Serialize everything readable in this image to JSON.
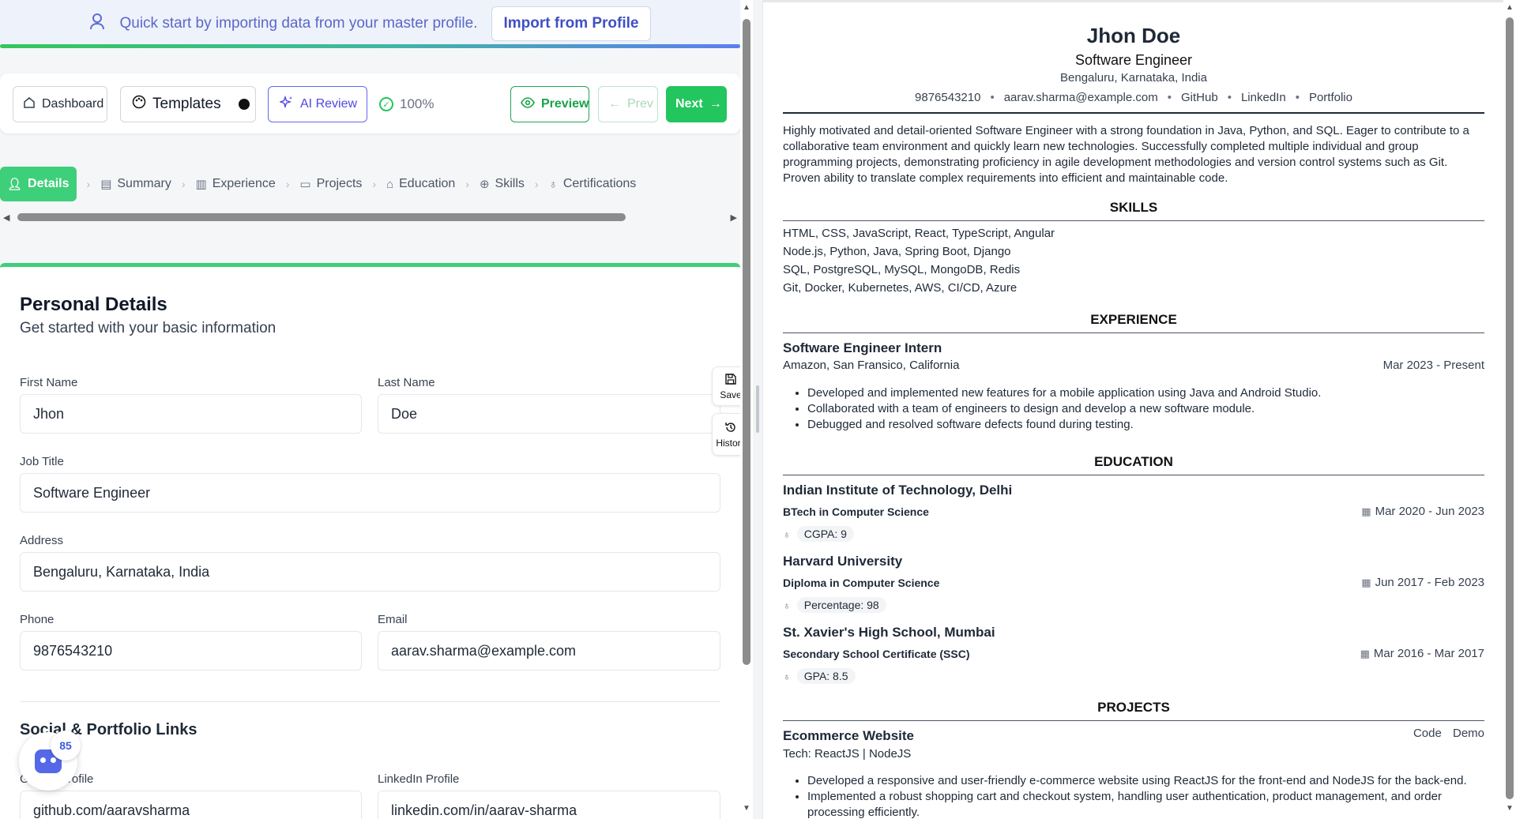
{
  "banner": {
    "text": "Quick start by importing data from your master profile.",
    "import_label": "Import from Profile"
  },
  "toolbar": {
    "dashboard": "Dashboard",
    "templates": "Templates",
    "ai_review": "AI Review",
    "completion": "100%",
    "preview": "Preview",
    "prev": "Prev",
    "next": "Next"
  },
  "steps": [
    {
      "label": "Details",
      "icon": "user-icon",
      "active": true
    },
    {
      "label": "Summary",
      "icon": "document-icon"
    },
    {
      "label": "Experience",
      "icon": "briefcase-icon"
    },
    {
      "label": "Projects",
      "icon": "folder-icon"
    },
    {
      "label": "Education",
      "icon": "graduation-cap-icon"
    },
    {
      "label": "Skills",
      "icon": "plus-circle-icon"
    },
    {
      "label": "Certifications",
      "icon": "award-icon"
    }
  ],
  "form": {
    "title": "Personal Details",
    "subtitle": "Get started with your basic information",
    "first_name_label": "First Name",
    "first_name": "Jhon",
    "last_name_label": "Last Name",
    "last_name": "Doe",
    "job_title_label": "Job Title",
    "job_title": "Software Engineer",
    "address_label": "Address",
    "address": "Bengaluru, Karnataka, India",
    "phone_label": "Phone",
    "phone": "9876543210",
    "email_label": "Email",
    "email": "aarav.sharma@example.com",
    "links_title": "Social & Portfolio Links",
    "github_label": "GitHub Profile",
    "github": "github.com/aaravsharma",
    "linkedin_label": "LinkedIn Profile",
    "linkedin": "linkedin.com/in/aarav-sharma"
  },
  "side": {
    "save": "Save",
    "history": "History"
  },
  "bot": {
    "score": "85"
  },
  "resume": {
    "name": "Jhon Doe",
    "role": "Software Engineer",
    "location": "Bengaluru, Karnataka, India",
    "phone": "9876543210",
    "email": "aarav.sharma@example.com",
    "links": [
      "GitHub",
      "LinkedIn",
      "Portfolio"
    ],
    "summary": "Highly motivated and detail-oriented Software Engineer with a strong foundation in Java, Python, and SQL. Eager to contribute to a collaborative team environment and quickly learn new technologies. Successfully completed multiple individual and group programming projects, demonstrating proficiency in agile development methodologies and version control systems such as Git. Proven ability to translate complex requirements into efficient and maintainable code.",
    "skills_heading": "SKILLS",
    "skills": [
      "HTML, CSS, JavaScript, React, TypeScript, Angular",
      "Node.js, Python, Java, Spring Boot, Django",
      "SQL, PostgreSQL, MySQL, MongoDB, Redis",
      "Git, Docker, Kubernetes, AWS, CI/CD, Azure"
    ],
    "experience_heading": "EXPERIENCE",
    "experience": {
      "title": "Software Engineer Intern",
      "company": "Amazon, San Fransico, California",
      "dates": "Mar 2023 - Present",
      "bullets": [
        "Developed and implemented new features for a mobile application using Java and Android Studio.",
        "Collaborated with a team of engineers to design and develop a new software module.",
        "Debugged and resolved software defects found during testing."
      ]
    },
    "education_heading": "EDUCATION",
    "education": [
      {
        "school": "Indian Institute of Technology, Delhi",
        "degree": "BTech in Computer Science",
        "dates": "Mar 2020 - Jun 2023",
        "grade": "CGPA: 9"
      },
      {
        "school": "Harvard University",
        "degree": "Diploma in Computer Science",
        "dates": "Jun 2017 - Feb 2023",
        "grade": "Percentage: 98"
      },
      {
        "school": "St. Xavier's High School, Mumbai",
        "degree": "Secondary School Certificate (SSC)",
        "dates": "Mar 2016 - Mar 2017",
        "grade": "GPA: 8.5"
      }
    ],
    "projects_heading": "PROJECTS",
    "project": {
      "title": "Ecommerce Website",
      "tech": "Tech: ReactJS | NodeJS",
      "code": "Code",
      "demo": "Demo",
      "bullets": [
        "Developed a responsive and user-friendly e-commerce website using ReactJS for the front-end and NodeJS for the back-end.",
        "Implemented a robust shopping cart and checkout system, handling user authentication, product management, and order processing efficiently."
      ]
    }
  }
}
